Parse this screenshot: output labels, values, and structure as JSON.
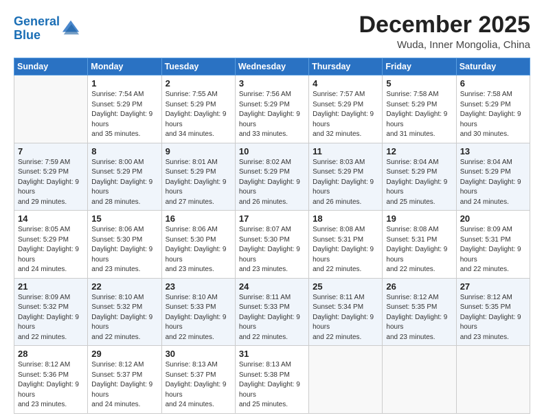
{
  "logo": {
    "line1": "General",
    "line2": "Blue"
  },
  "title": "December 2025",
  "location": "Wuda, Inner Mongolia, China",
  "weekdays": [
    "Sunday",
    "Monday",
    "Tuesday",
    "Wednesday",
    "Thursday",
    "Friday",
    "Saturday"
  ],
  "weeks": [
    [
      {
        "day": "",
        "sunrise": "",
        "sunset": "",
        "daylight": "",
        "empty": true
      },
      {
        "day": "1",
        "sunrise": "Sunrise: 7:54 AM",
        "sunset": "Sunset: 5:29 PM",
        "daylight": "Daylight: 9 hours and 35 minutes."
      },
      {
        "day": "2",
        "sunrise": "Sunrise: 7:55 AM",
        "sunset": "Sunset: 5:29 PM",
        "daylight": "Daylight: 9 hours and 34 minutes."
      },
      {
        "day": "3",
        "sunrise": "Sunrise: 7:56 AM",
        "sunset": "Sunset: 5:29 PM",
        "daylight": "Daylight: 9 hours and 33 minutes."
      },
      {
        "day": "4",
        "sunrise": "Sunrise: 7:57 AM",
        "sunset": "Sunset: 5:29 PM",
        "daylight": "Daylight: 9 hours and 32 minutes."
      },
      {
        "day": "5",
        "sunrise": "Sunrise: 7:58 AM",
        "sunset": "Sunset: 5:29 PM",
        "daylight": "Daylight: 9 hours and 31 minutes."
      },
      {
        "day": "6",
        "sunrise": "Sunrise: 7:58 AM",
        "sunset": "Sunset: 5:29 PM",
        "daylight": "Daylight: 9 hours and 30 minutes."
      }
    ],
    [
      {
        "day": "7",
        "sunrise": "Sunrise: 7:59 AM",
        "sunset": "Sunset: 5:29 PM",
        "daylight": "Daylight: 9 hours and 29 minutes."
      },
      {
        "day": "8",
        "sunrise": "Sunrise: 8:00 AM",
        "sunset": "Sunset: 5:29 PM",
        "daylight": "Daylight: 9 hours and 28 minutes."
      },
      {
        "day": "9",
        "sunrise": "Sunrise: 8:01 AM",
        "sunset": "Sunset: 5:29 PM",
        "daylight": "Daylight: 9 hours and 27 minutes."
      },
      {
        "day": "10",
        "sunrise": "Sunrise: 8:02 AM",
        "sunset": "Sunset: 5:29 PM",
        "daylight": "Daylight: 9 hours and 26 minutes."
      },
      {
        "day": "11",
        "sunrise": "Sunrise: 8:03 AM",
        "sunset": "Sunset: 5:29 PM",
        "daylight": "Daylight: 9 hours and 26 minutes."
      },
      {
        "day": "12",
        "sunrise": "Sunrise: 8:04 AM",
        "sunset": "Sunset: 5:29 PM",
        "daylight": "Daylight: 9 hours and 25 minutes."
      },
      {
        "day": "13",
        "sunrise": "Sunrise: 8:04 AM",
        "sunset": "Sunset: 5:29 PM",
        "daylight": "Daylight: 9 hours and 24 minutes."
      }
    ],
    [
      {
        "day": "14",
        "sunrise": "Sunrise: 8:05 AM",
        "sunset": "Sunset: 5:29 PM",
        "daylight": "Daylight: 9 hours and 24 minutes."
      },
      {
        "day": "15",
        "sunrise": "Sunrise: 8:06 AM",
        "sunset": "Sunset: 5:30 PM",
        "daylight": "Daylight: 9 hours and 23 minutes."
      },
      {
        "day": "16",
        "sunrise": "Sunrise: 8:06 AM",
        "sunset": "Sunset: 5:30 PM",
        "daylight": "Daylight: 9 hours and 23 minutes."
      },
      {
        "day": "17",
        "sunrise": "Sunrise: 8:07 AM",
        "sunset": "Sunset: 5:30 PM",
        "daylight": "Daylight: 9 hours and 23 minutes."
      },
      {
        "day": "18",
        "sunrise": "Sunrise: 8:08 AM",
        "sunset": "Sunset: 5:31 PM",
        "daylight": "Daylight: 9 hours and 22 minutes."
      },
      {
        "day": "19",
        "sunrise": "Sunrise: 8:08 AM",
        "sunset": "Sunset: 5:31 PM",
        "daylight": "Daylight: 9 hours and 22 minutes."
      },
      {
        "day": "20",
        "sunrise": "Sunrise: 8:09 AM",
        "sunset": "Sunset: 5:31 PM",
        "daylight": "Daylight: 9 hours and 22 minutes."
      }
    ],
    [
      {
        "day": "21",
        "sunrise": "Sunrise: 8:09 AM",
        "sunset": "Sunset: 5:32 PM",
        "daylight": "Daylight: 9 hours and 22 minutes."
      },
      {
        "day": "22",
        "sunrise": "Sunrise: 8:10 AM",
        "sunset": "Sunset: 5:32 PM",
        "daylight": "Daylight: 9 hours and 22 minutes."
      },
      {
        "day": "23",
        "sunrise": "Sunrise: 8:10 AM",
        "sunset": "Sunset: 5:33 PM",
        "daylight": "Daylight: 9 hours and 22 minutes."
      },
      {
        "day": "24",
        "sunrise": "Sunrise: 8:11 AM",
        "sunset": "Sunset: 5:33 PM",
        "daylight": "Daylight: 9 hours and 22 minutes."
      },
      {
        "day": "25",
        "sunrise": "Sunrise: 8:11 AM",
        "sunset": "Sunset: 5:34 PM",
        "daylight": "Daylight: 9 hours and 22 minutes."
      },
      {
        "day": "26",
        "sunrise": "Sunrise: 8:12 AM",
        "sunset": "Sunset: 5:35 PM",
        "daylight": "Daylight: 9 hours and 23 minutes."
      },
      {
        "day": "27",
        "sunrise": "Sunrise: 8:12 AM",
        "sunset": "Sunset: 5:35 PM",
        "daylight": "Daylight: 9 hours and 23 minutes."
      }
    ],
    [
      {
        "day": "28",
        "sunrise": "Sunrise: 8:12 AM",
        "sunset": "Sunset: 5:36 PM",
        "daylight": "Daylight: 9 hours and 23 minutes."
      },
      {
        "day": "29",
        "sunrise": "Sunrise: 8:12 AM",
        "sunset": "Sunset: 5:37 PM",
        "daylight": "Daylight: 9 hours and 24 minutes."
      },
      {
        "day": "30",
        "sunrise": "Sunrise: 8:13 AM",
        "sunset": "Sunset: 5:37 PM",
        "daylight": "Daylight: 9 hours and 24 minutes."
      },
      {
        "day": "31",
        "sunrise": "Sunrise: 8:13 AM",
        "sunset": "Sunset: 5:38 PM",
        "daylight": "Daylight: 9 hours and 25 minutes."
      },
      {
        "day": "",
        "sunrise": "",
        "sunset": "",
        "daylight": "",
        "empty": true
      },
      {
        "day": "",
        "sunrise": "",
        "sunset": "",
        "daylight": "",
        "empty": true
      },
      {
        "day": "",
        "sunrise": "",
        "sunset": "",
        "daylight": "",
        "empty": true
      }
    ]
  ]
}
